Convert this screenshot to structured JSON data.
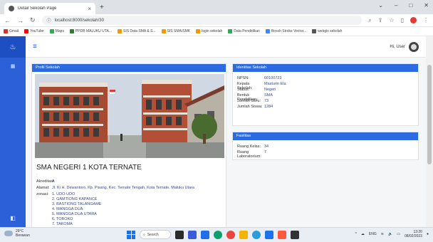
{
  "browser": {
    "tab_title": "Detail Sekolah Page",
    "url": "localhost:8000/sekolah/30",
    "bookmarks": [
      {
        "label": "Gmail",
        "color": "#d93025"
      },
      {
        "label": "YouTube",
        "color": "#ff0000"
      },
      {
        "label": "Maps",
        "color": "#34a853"
      },
      {
        "label": "PPDB MALUKU UTA...",
        "color": "#2e7d32"
      },
      {
        "label": "SIS Data SMA & S...",
        "color": "#f29900"
      },
      {
        "label": "SIS SMA/SMK",
        "color": "#f29900"
      },
      {
        "label": "login sekolah",
        "color": "#f29900"
      },
      {
        "label": "Data Pendidikan",
        "color": "#34a853"
      },
      {
        "label": "Bosch Stroke Vector...",
        "color": "#4285f4"
      },
      {
        "label": "webgis sekolah",
        "color": "#555555"
      }
    ]
  },
  "topnav": {
    "user_greeting": "Hi, User"
  },
  "profil": {
    "header": "Profil Sekolah",
    "school_name": "SMA NEGERI 1 KOTA TERNATE",
    "dot": ":",
    "akreditasi_label": "Akreditasi:",
    "akreditasi_value": "A",
    "alamat_label": "Alamat:",
    "alamat_value": "Jl. Ki H. Dewantoro, Kp. Pisang, Kec. Ternate Tengah, Kota Ternate, Maluku Utara",
    "zonasi_label": "zonasi:",
    "zonasi": [
      "1. UDO-UDO",
      "2. GAMTIONG KAPANCE",
      "3. BASTIONG TALANGAME",
      "4. MANGGA DUA",
      "5. MANGGA DUA UTARA",
      "6. TOBOKO",
      "7. TAKOMA"
    ]
  },
  "identitas": {
    "header": "Identitas Sekolah",
    "rows": [
      {
        "k": "NPSN:",
        "v": "60100723"
      },
      {
        "k": "Kepala Sekolah:",
        "v": "Masturin Ela"
      },
      {
        "k": "Status:",
        "v": "Negeri"
      },
      {
        "k": "Bentuk Pendidikan:",
        "v": "SMA"
      },
      {
        "k": "Jumlah Guru:",
        "v": "73"
      },
      {
        "k": "Jumlah Siswa:",
        "v": "1284"
      }
    ]
  },
  "fasilitas": {
    "header": "Fasilitas",
    "rows": [
      {
        "k": "Ruang Kelas:",
        "v": "34"
      },
      {
        "k": "Ruang Laboratorium:",
        "v": "7"
      }
    ]
  },
  "taskbar": {
    "temp": "29°C",
    "weather": "Berawan",
    "search": "Search",
    "lang": "ENG",
    "time": "13:20",
    "date": "08/02/2023"
  },
  "colors": {
    "accent": "#2b6ae0",
    "sidebar": "#2b60d9"
  }
}
